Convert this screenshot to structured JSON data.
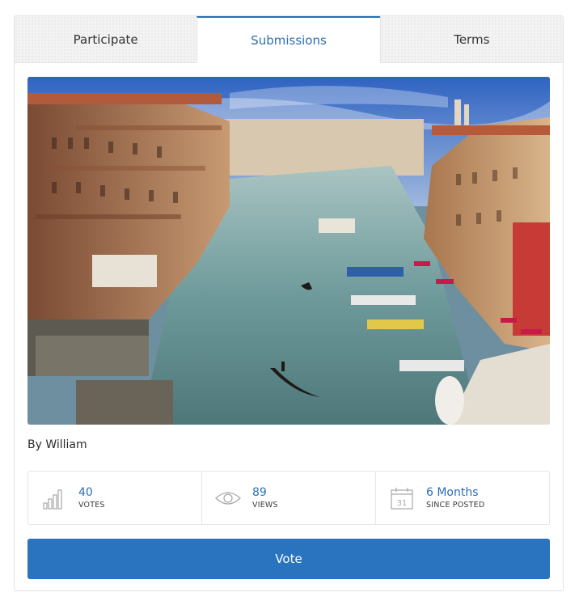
{
  "tabs": [
    {
      "label": "Participate",
      "active": false
    },
    {
      "label": "Submissions",
      "active": true
    },
    {
      "label": "Terms",
      "active": false
    }
  ],
  "submission": {
    "author": "By William",
    "image_alt": "Venice Grand Canal with gondolas"
  },
  "stats": {
    "votes": {
      "value": "40",
      "label": "VOTES",
      "icon": "bar-chart-icon"
    },
    "views": {
      "value": "89",
      "label": "VIEWS",
      "icon": "eye-icon"
    },
    "posted": {
      "value": "6 Months",
      "label": "SINCE POSTED",
      "icon": "calendar-icon",
      "calendar_day": "31"
    }
  },
  "vote_button": {
    "label": "Vote"
  },
  "colors": {
    "accent": "#2a73bf",
    "link": "#2a6fb5",
    "border": "#e2e2e2"
  }
}
